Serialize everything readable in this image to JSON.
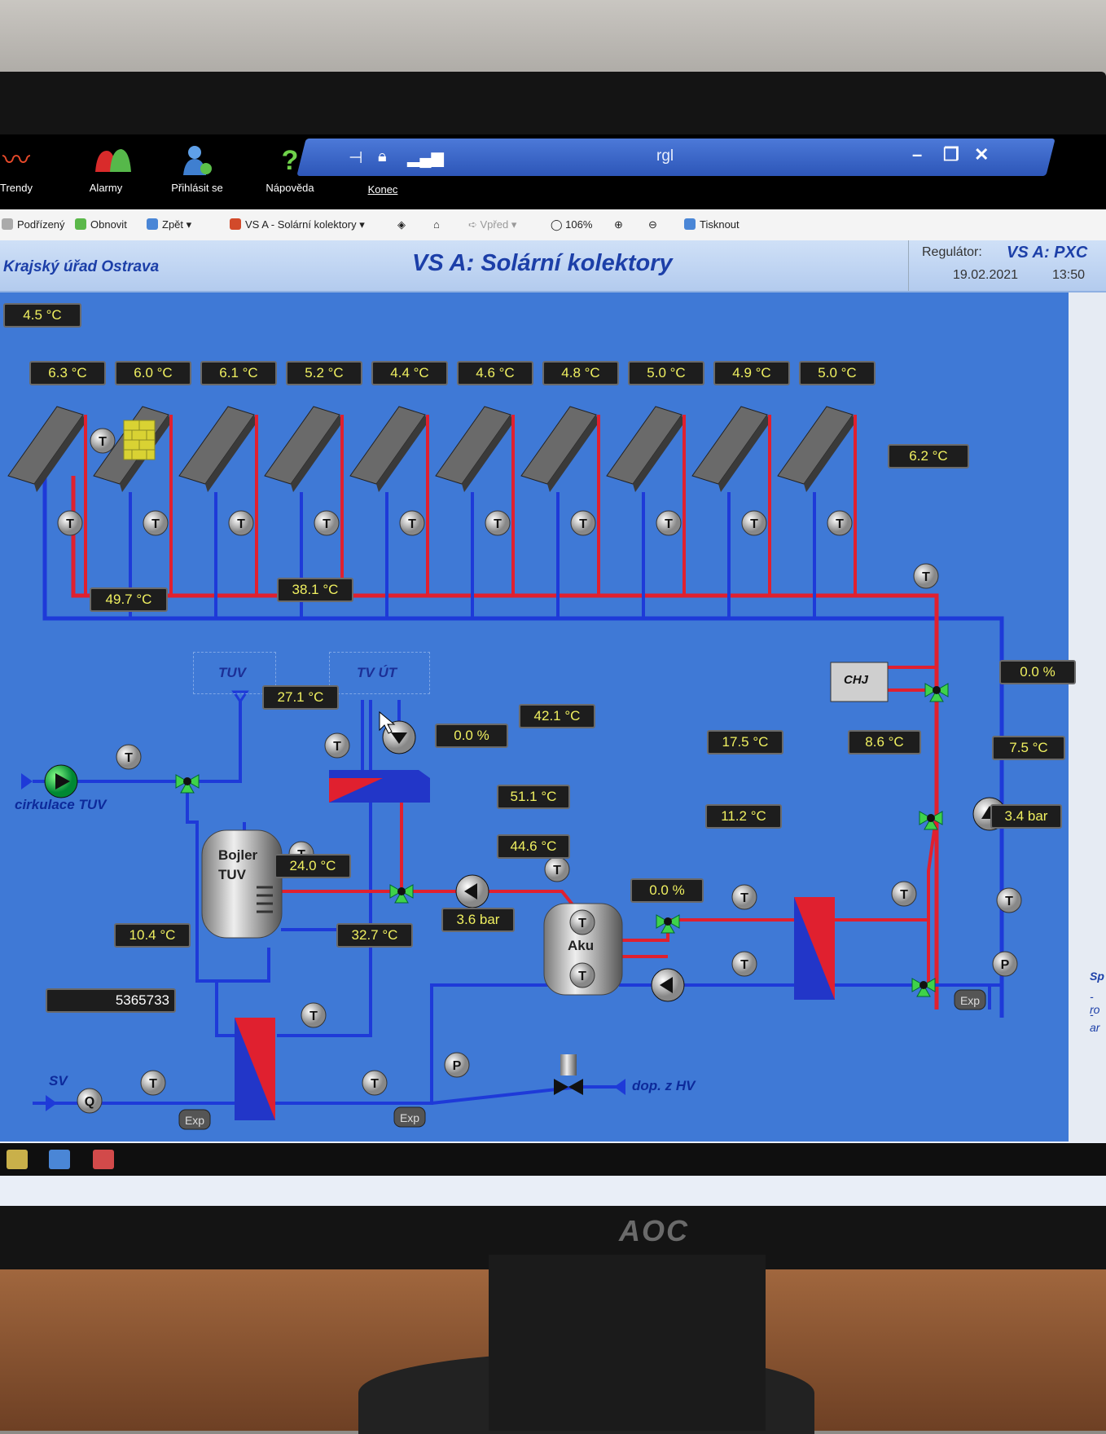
{
  "toolbar": {
    "trendy": "Trendy",
    "alarmy": "Alarmy",
    "prihlasit": "Přihlásit se",
    "napoveda": "Nápověda",
    "konec": "Konec",
    "window_title": "rgl"
  },
  "nav": {
    "podrizeny": "Podřízený",
    "obnovit": "Obnovit",
    "zpet": "Zpět",
    "page": "VS A - Solární kolektory",
    "vpred": "Vpřed",
    "zoom": "106%",
    "tisknout": "Tisknout"
  },
  "header": {
    "org": "Krajský úřad Ostrava",
    "title": "VS A: Solární kolektory",
    "regulator_label": "Regulátor:",
    "regulator_value": "VS A: PXC",
    "date": "19.02.2021",
    "time": "13:50"
  },
  "outdoor": {
    "temp": "4.5 °C"
  },
  "collectors": [
    "6.3 °C",
    "6.0 °C",
    "6.1 °C",
    "5.2 °C",
    "4.4 °C",
    "4.6 °C",
    "4.8 °C",
    "5.0 °C",
    "4.9 °C",
    "5.0 °C"
  ],
  "collector_out": "6.2 °C",
  "labels": {
    "tuv": "TUV",
    "tv_ut": "TV ÚT",
    "cirkulace": "cirkulace TUV",
    "chj": "CHJ",
    "bojler": "Bojler TUV",
    "aku": "Aku",
    "sv": "SV",
    "dop": "dop. z HV",
    "exp": "Exp",
    "t": "T",
    "p": "P",
    "q": "Q",
    "sidebar_text": "Sp",
    "sidebar_r": "- ro",
    "sidebar_a": "- ar"
  },
  "readings": {
    "cirk_temp": "49.7 °C",
    "tvut_temp": "38.1 °C",
    "bojler_temp": "27.1 °C",
    "pump_left": "0.0 %",
    "aku_top_in": "42.1 °C",
    "aku_top": "51.1 °C",
    "aku_bottom": "44.6 °C",
    "hx_sec_sup": "17.5 °C",
    "hx_sec_ret": "11.2 °C",
    "pump_mid": "0.0 %",
    "hx_prim": "8.6 °C",
    "right_ret": "7.5 °C",
    "pump_right": "0.0 %",
    "right_press": "3.4 bar",
    "bottom_hx": "24.0 °C",
    "sv_temp": "10.4 °C",
    "mix_temp": "32.7 °C",
    "bottom_press": "3.6 bar",
    "water_meter": "5365733"
  }
}
